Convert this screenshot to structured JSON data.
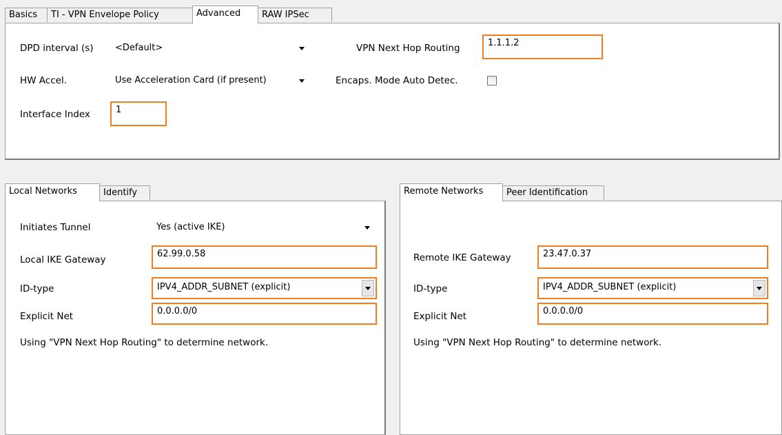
{
  "top_tabs": [
    "Basics",
    "TI - VPN Envelope Policy",
    "Advanced",
    "RAW IPSec"
  ],
  "advanced": {
    "dpd_label": "DPD interval (s)",
    "dpd_value": "<Default>",
    "hw_label": "HW Accel.",
    "hw_value": "Use Acceleration Card (if present)",
    "iface_label": "Interface Index",
    "iface_value": "1",
    "nexthop_label": "VPN Next Hop Routing",
    "nexthop_value": "1.1.1.2",
    "encaps_label": "Encaps. Mode Auto Detec."
  },
  "local": {
    "tabs": [
      "Local Networks",
      "Identify"
    ],
    "initiates_label": "Initiates Tunnel",
    "initiates_value": "Yes (active IKE)",
    "gateway_label": "Local IKE Gateway",
    "gateway_value": "62.99.0.58",
    "idtype_label": "ID-type",
    "idtype_value": "IPV4_ADDR_SUBNET (explicit)",
    "net_label": "Explicit Net",
    "net_value": "0.0.0.0/0",
    "note": "Using \"VPN Next Hop Routing\" to determine network."
  },
  "remote": {
    "tabs": [
      "Remote Networks",
      "Peer Identification"
    ],
    "gateway_label": "Remote IKE Gateway",
    "gateway_value": "23.47.0.37",
    "idtype_label": "ID-type",
    "idtype_value": "IPV4_ADDR_SUBNET (explicit)",
    "net_label": "Explicit Net",
    "net_value": "0.0.0.0/0",
    "note": "Using \"VPN Next Hop Routing\" to determine network."
  },
  "colors": {
    "highlight": "#f07d1e",
    "panel": "#ffffff",
    "background": "#f0f0f0"
  }
}
